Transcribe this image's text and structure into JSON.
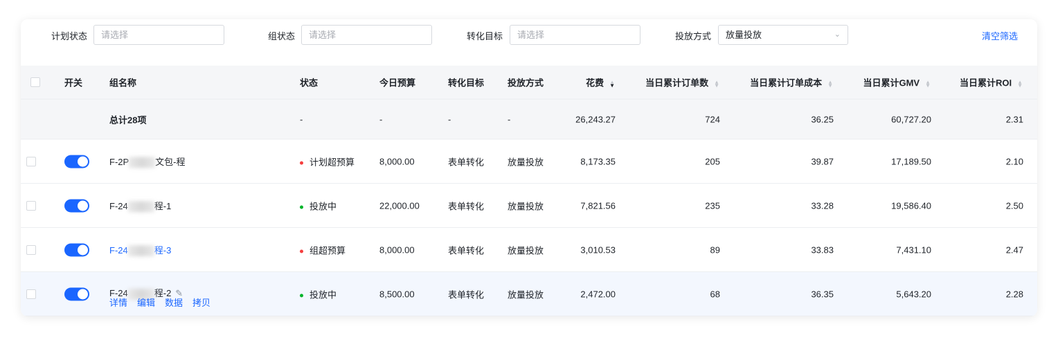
{
  "filters": {
    "plan_status": {
      "label": "计划状态",
      "placeholder": "请选择"
    },
    "group_status": {
      "label": "组状态",
      "placeholder": "请选择"
    },
    "conversion_goal": {
      "label": "转化目标",
      "placeholder": "请选择"
    },
    "delivery_method": {
      "label": "投放方式",
      "value": "放量投放"
    },
    "clear_label": "清空筛选"
  },
  "columns": [
    "开关",
    "组名称",
    "状态",
    "今日预算",
    "转化目标",
    "投放方式",
    "花费",
    "当日累计订单数",
    "当日累计订单成本",
    "当日累计GMV",
    "当日累计ROI"
  ],
  "summary": {
    "label": "总计28项",
    "status": "-",
    "budget": "-",
    "goal": "-",
    "method": "-",
    "spend": "26,243.27",
    "orders": "724",
    "cost": "36.25",
    "gmv": "60,727.20",
    "roi": "2.31"
  },
  "rows": [
    {
      "name_a": "F-2P",
      "name_b": "文包-程",
      "status": "计划超预算",
      "status_color": "#f53f3f",
      "budget": "8,000.00",
      "goal": "表单转化",
      "method": "放量投放",
      "spend": "8,173.35",
      "orders": "205",
      "cost": "39.87",
      "gmv": "17,189.50",
      "roi": "2.10"
    },
    {
      "name_a": "F-24",
      "name_b": "程-1",
      "status": "投放中",
      "status_color": "#00b42a",
      "budget": "22,000.00",
      "goal": "表单转化",
      "method": "放量投放",
      "spend": "7,821.56",
      "orders": "235",
      "cost": "33.28",
      "gmv": "19,586.40",
      "roi": "2.50"
    },
    {
      "name_a": "F-24",
      "name_b": "程-3",
      "status": "组超预算",
      "status_color": "#f53f3f",
      "budget": "8,000.00",
      "goal": "表单转化",
      "method": "放量投放",
      "spend": "3,010.53",
      "orders": "89",
      "cost": "33.83",
      "gmv": "7,431.10",
      "roi": "2.47"
    },
    {
      "name_a": "F-24",
      "name_b": "程-2",
      "status": "投放中",
      "status_color": "#00b42a",
      "budget": "8,500.00",
      "goal": "表单转化",
      "method": "放量投放",
      "spend": "2,472.00",
      "orders": "68",
      "cost": "36.35",
      "gmv": "5,643.20",
      "roi": "2.28",
      "actions": [
        "详情",
        "编辑",
        "数据",
        "拷贝"
      ]
    }
  ]
}
